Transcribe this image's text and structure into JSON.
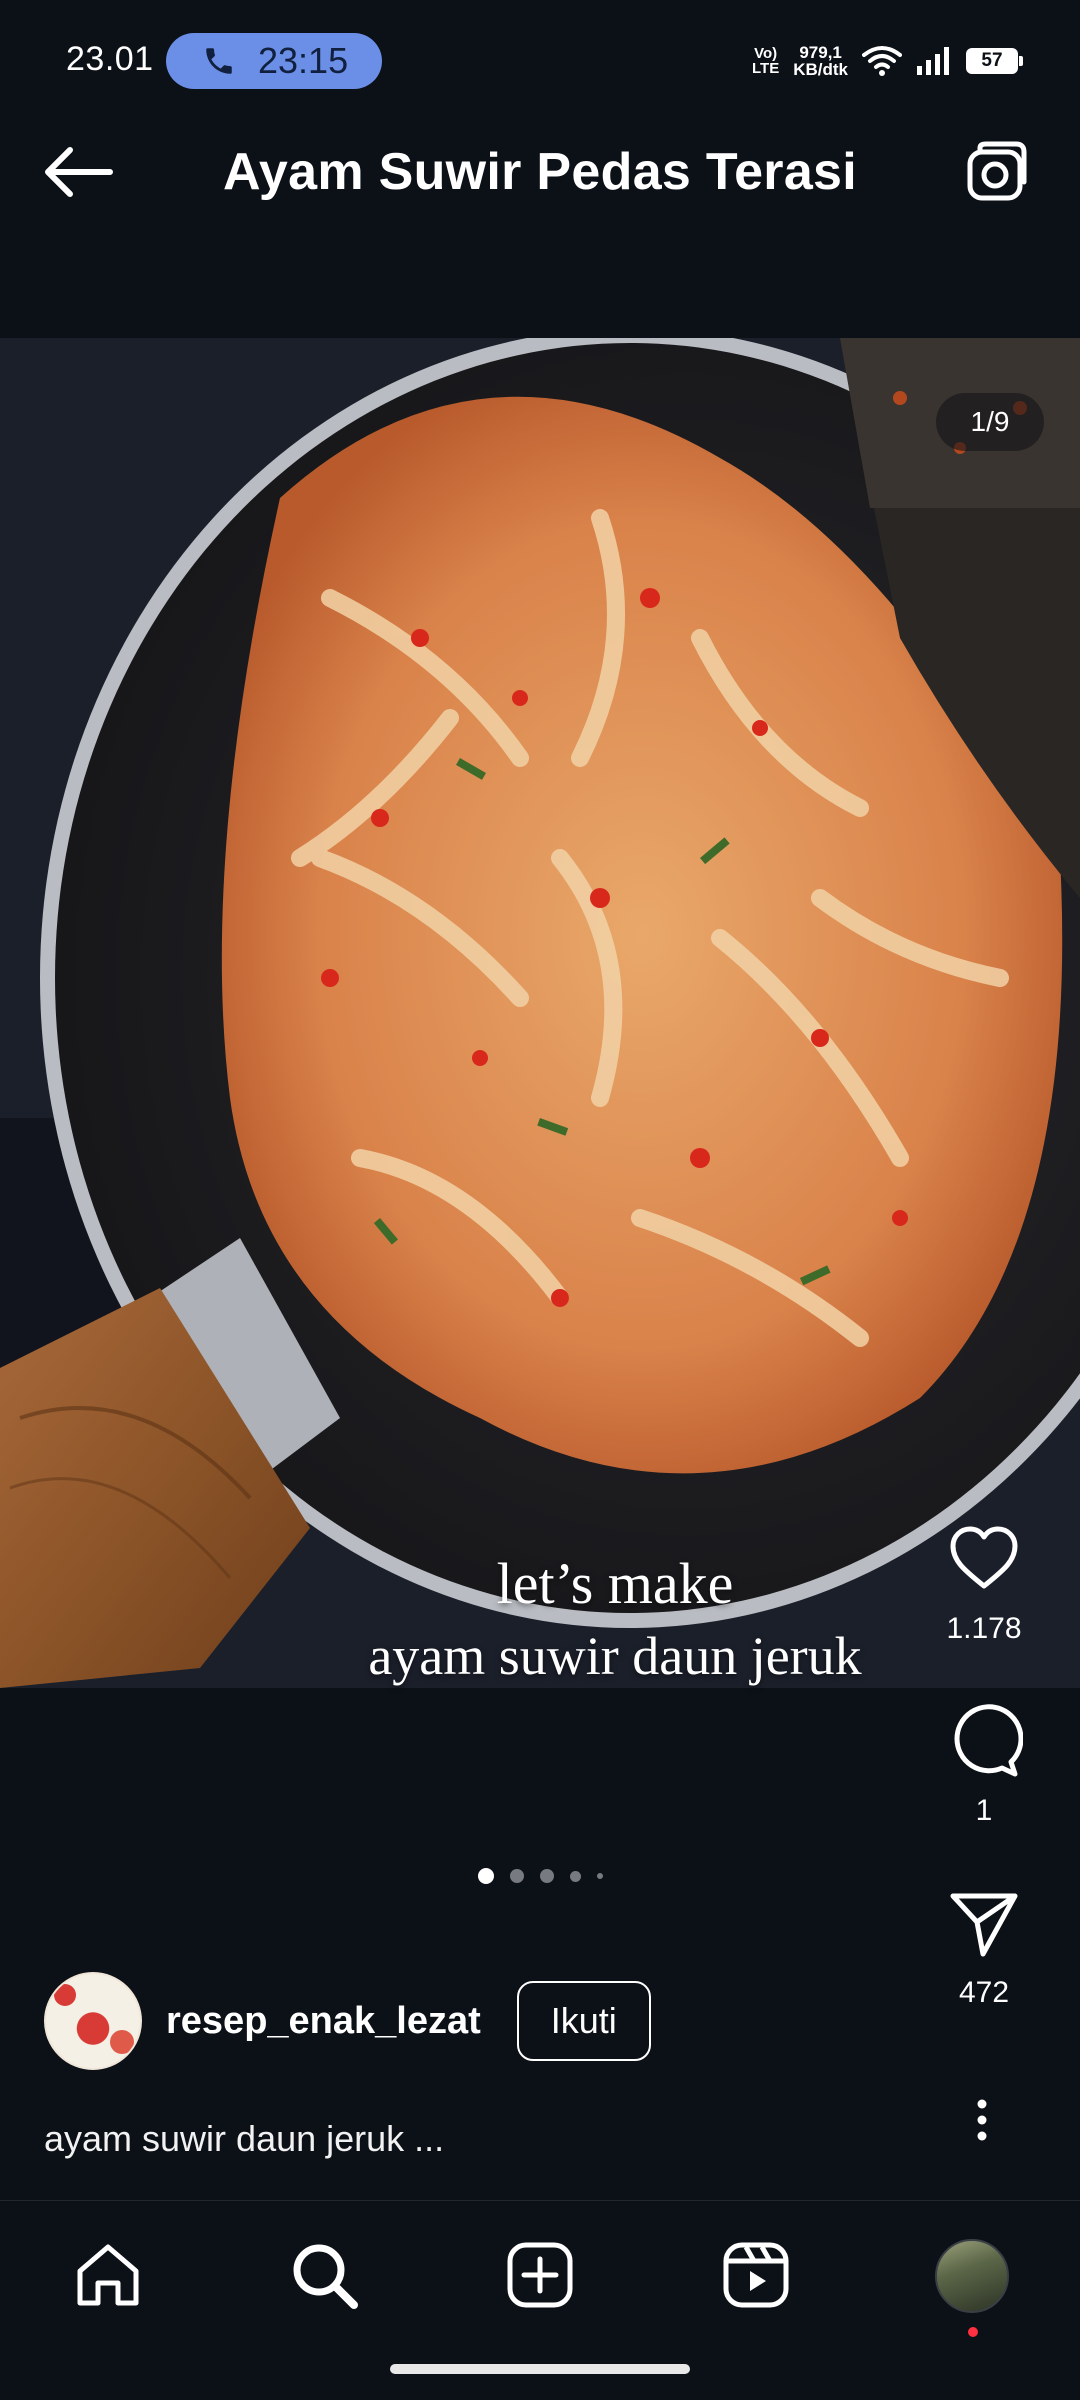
{
  "status_bar": {
    "time": "23.01",
    "call_timer": "23:15",
    "volte_line1": "Vo)",
    "volte_line2": "LTE",
    "net_speed_value": "979,1",
    "net_speed_unit": "KB/dtk",
    "battery": "57"
  },
  "header": {
    "title": "Ayam Suwir Pedas Terasi"
  },
  "post": {
    "image_counter": "1/9",
    "overlay_line1": "let’s make",
    "overlay_line2": "ayam suwir daun jeruk",
    "likes": "1.178",
    "comments": "1",
    "shares": "472",
    "author": "resep_enak_lezat",
    "follow_label": "Ikuti",
    "caption": "ayam suwir daun jeruk ..."
  },
  "carousel": {
    "total_dots": 5,
    "active_index": 0
  },
  "icons": {
    "back": "arrow-left-icon",
    "camera": "camera-icon",
    "like": "heart-icon",
    "comment": "comment-icon",
    "share": "send-icon",
    "more": "more-vertical-icon",
    "nav": [
      "home-icon",
      "search-icon",
      "add-post-icon",
      "reels-icon",
      "profile-avatar"
    ]
  },
  "colors": {
    "background": "#0c1017",
    "call_pill": "#6b8fe6",
    "notification_dot": "#ff3040"
  }
}
